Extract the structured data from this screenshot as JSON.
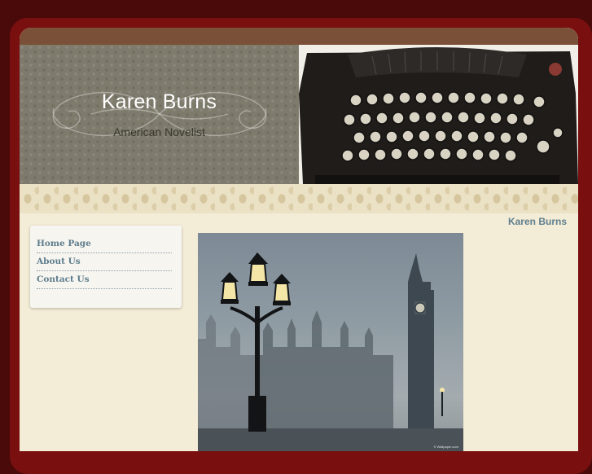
{
  "site": {
    "title": "Karen Burns",
    "subtitle": "American Novelist"
  },
  "header": {
    "image_icon": "typewriter-image"
  },
  "page_heading": "Karen Burns",
  "nav": {
    "items": [
      {
        "label": "Home Page"
      },
      {
        "label": "About Us"
      },
      {
        "label": "Contact Us"
      }
    ]
  },
  "photo": {
    "icon": "foggy-london-streetlamp-photo",
    "credit": "© Wallpaper.com"
  },
  "colors": {
    "outer_frame": "#7a0f10",
    "top_bar": "#7a5138",
    "header_pattern": "#7e7a6c",
    "page_bg": "#f3ecd6",
    "link": "#5e7d8d"
  }
}
